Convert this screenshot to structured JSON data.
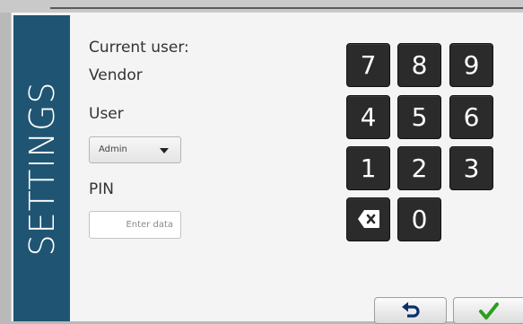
{
  "side_banner": {
    "title": "SETTINGS"
  },
  "current_user": {
    "caption": "Current user:",
    "value": "Vendor"
  },
  "user_field": {
    "caption": "User",
    "selected": "Admin"
  },
  "pin_field": {
    "caption": "PIN",
    "placeholder": "Enter data"
  },
  "keypad": {
    "keys": [
      "7",
      "8",
      "9",
      "4",
      "5",
      "6",
      "1",
      "2",
      "3",
      "0"
    ],
    "backspace_icon": "backspace-icon"
  },
  "actions": {
    "back_icon": "undo-arrow-icon",
    "confirm_icon": "checkmark-icon",
    "back_color": "#0b2f6e",
    "confirm_color": "#2c9e1f"
  },
  "colors": {
    "banner": "#1f5572",
    "key_bg": "#2b2b2b",
    "panel_bg": "#f4f4f4"
  }
}
